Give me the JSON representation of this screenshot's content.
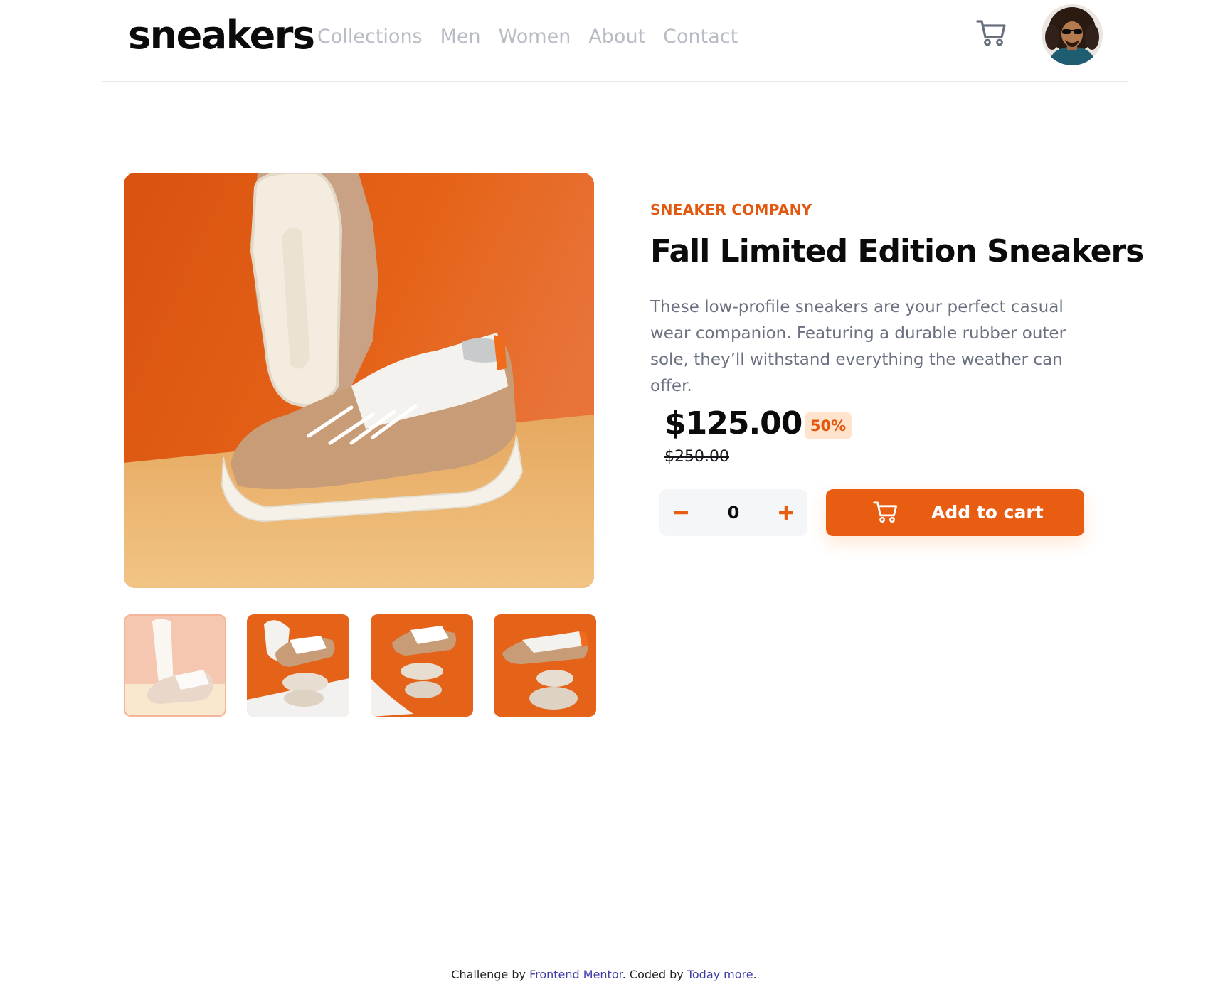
{
  "header": {
    "logo": "sneakers",
    "nav": [
      "Collections",
      "Men",
      "Women",
      "About",
      "Contact"
    ],
    "cart_icon": "cart-icon",
    "avatar_icon": "user-avatar"
  },
  "gallery": {
    "main_image": "product-photo-sneakers",
    "thumbnails": [
      "product-thumbnail-1",
      "product-thumbnail-2",
      "product-thumbnail-3",
      "product-thumbnail-4"
    ],
    "active_thumbnail": 1
  },
  "product": {
    "company": "SNEAKER COMPANY",
    "title": "Fall Limited Edition Sneakers",
    "description": "These low-profile sneakers are your perfect casual wear companion. Featuring a durable rubber outer sole, they’ll withstand everything the weather can offer.",
    "price": "$125.00",
    "discount": "50%",
    "original_price": "$250.00",
    "quantity": "0",
    "minus_icon": "minus-icon",
    "plus_icon": "plus-icon",
    "add_to_cart_label": "Add to cart"
  },
  "footer": {
    "prefix": "Challenge by ",
    "link1": "Frontend Mentor",
    "middle": ". Coded by ",
    "link2": "Today more",
    "suffix": "."
  },
  "colors": {
    "accent": "#e85d12",
    "accent_text": "#e3580f",
    "discount_bg": "#ffe3cc",
    "nav_text": "#b8bcc4",
    "body_text": "#6b7180"
  }
}
